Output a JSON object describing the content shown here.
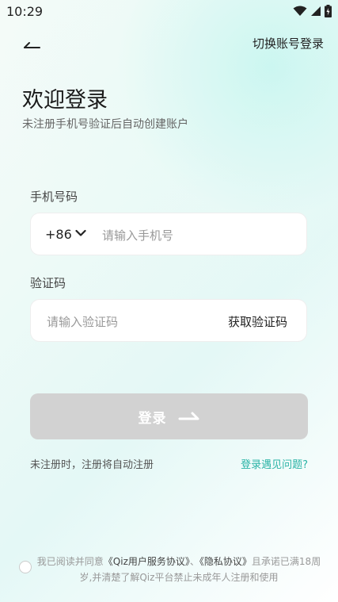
{
  "status_bar": {
    "time": "10:29"
  },
  "header": {
    "switch_account": "切换账号登录"
  },
  "welcome": {
    "title": "欢迎登录",
    "subtitle": "未注册手机号验证后自动创建账户"
  },
  "phone": {
    "label": "手机号码",
    "country_code": "+86",
    "placeholder": "请输入手机号",
    "value": ""
  },
  "code": {
    "label": "验证码",
    "placeholder": "请输入验证码",
    "value": "",
    "get_code": "获取验证码"
  },
  "login": {
    "label": "登录"
  },
  "hints": {
    "auto_register": "未注册时，注册将自动注册",
    "problem": "登录遇见问题?"
  },
  "agreement": {
    "prefix": "我已阅读并同意",
    "user_agreement": "《Qiz用户服务协议》",
    "sep": "、",
    "privacy": "《隐私协议》",
    "suffix": "且承诺已满18周岁,并清楚了解Qiz平台禁止未成年人注册和使用",
    "checked": false
  },
  "colors": {
    "accent": "#2ab3a6",
    "button_disabled": "#d2d2d2"
  }
}
